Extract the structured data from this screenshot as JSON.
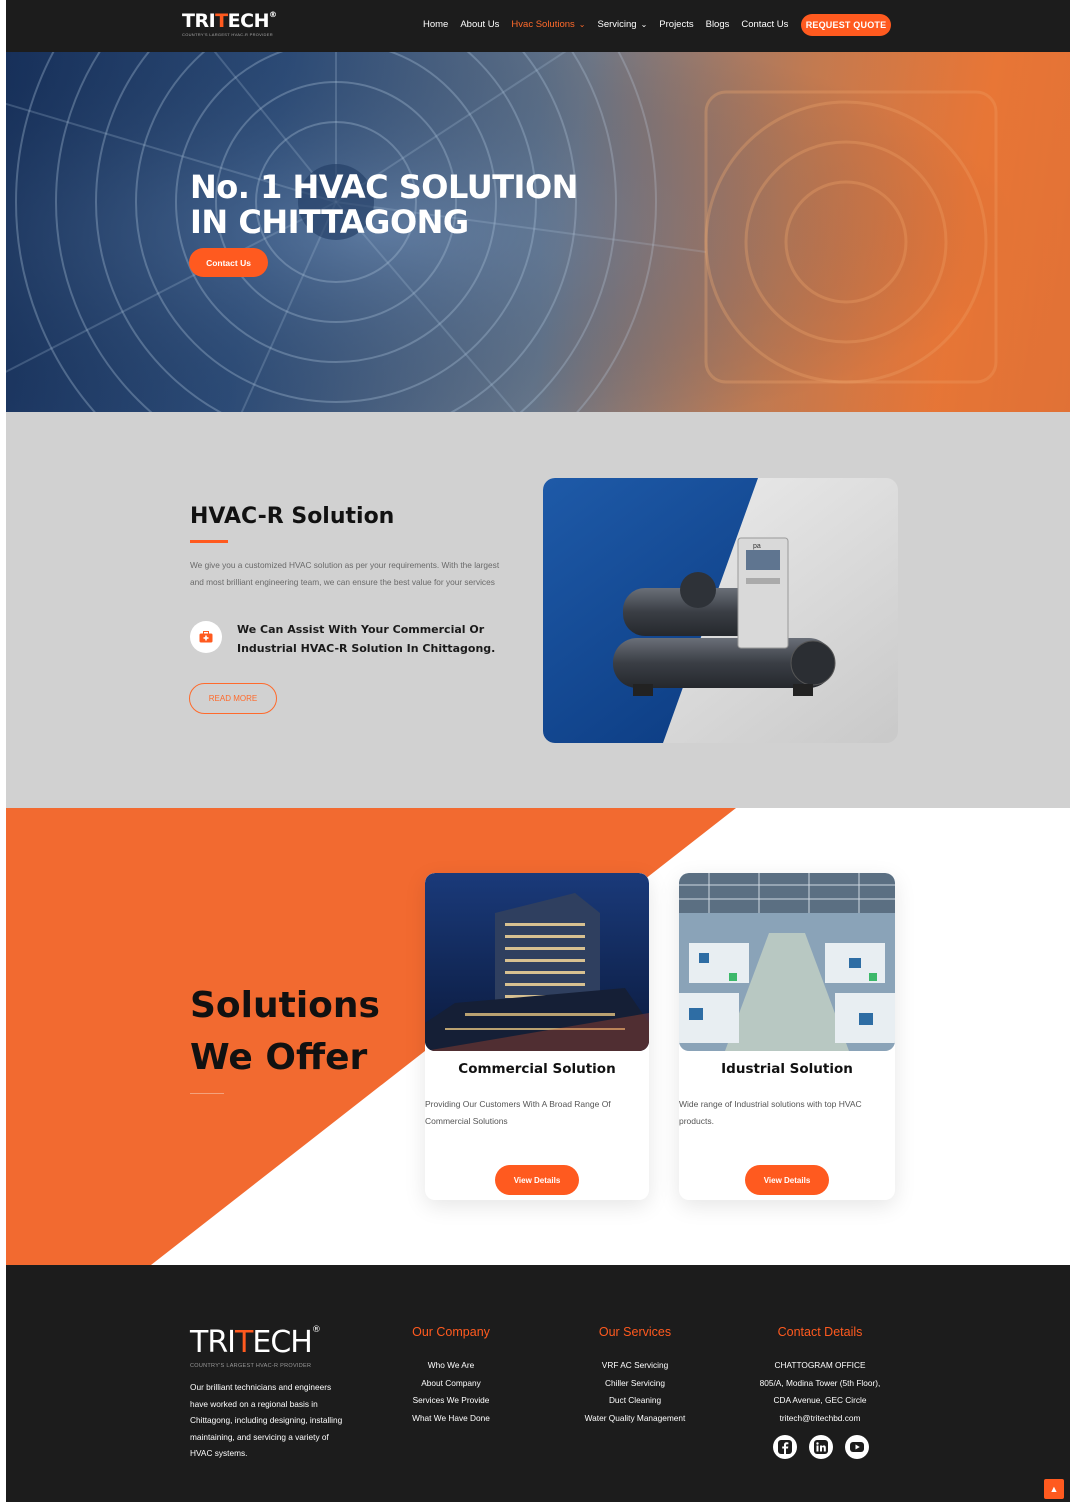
{
  "nav": {
    "logo": {
      "pre": "TRI",
      "mark": "T",
      "post": "ECH",
      "reg": "®"
    },
    "tagline": "COUNTRY'S LARGEST HVAC-R PROVIDER",
    "links": [
      {
        "label": "Home"
      },
      {
        "label": "About Us"
      },
      {
        "label": "Hvac Solutions",
        "dropdown": true,
        "active": true
      },
      {
        "label": "Servicing",
        "dropdown": true
      },
      {
        "label": "Projects"
      },
      {
        "label": "Blogs"
      },
      {
        "label": "Contact Us"
      }
    ],
    "quote_button": "REQUEST QUOTE"
  },
  "hero": {
    "title_line1": "No. 1 HVAC SOLUTION",
    "title_line2": "IN CHITTAGONG",
    "button": "Contact Us"
  },
  "hvac": {
    "title": "HVAC-R Solution",
    "description": "We give you a customized HVAC solution as per your requirements. With the largest and most brilliant engineering team, we can ensure the best value for your services",
    "assist_text": "We Can Assist With Your Commercial Or Industrial HVAC-R Solution In Chittagong.",
    "read_more": "READ MORE",
    "image_badge": "pa"
  },
  "solutions": {
    "title_line1": "Solutions",
    "title_line2": "We Offer",
    "cards": [
      {
        "title": "Commercial Solution",
        "description": "Providing Our Customers With A Broad Range Of Commercial Solutions",
        "button": "View Details"
      },
      {
        "title": "Idustrial Solution",
        "description": "Wide range of Industrial solutions with top HVAC products.",
        "button": "View Details"
      }
    ]
  },
  "footer": {
    "logo": {
      "pre": "TRI",
      "mark": "T",
      "post": "ECH",
      "reg": "®"
    },
    "tagline": "COUNTRY'S LARGEST HVAC-R PROVIDER",
    "about": "Our brilliant technicians and engineers have worked on a regional basis in Chittagong, including designing, installing maintaining, and servicing a variety of HVAC systems.",
    "company": {
      "title": "Our Company",
      "links": [
        "Who We Are",
        "About Company",
        "Services We Provide",
        "What We Have Done"
      ]
    },
    "services": {
      "title": "Our Services",
      "links": [
        "VRF AC Servicing",
        "Chiller Servicing",
        "Duct Cleaning",
        "Water Quality Management"
      ]
    },
    "contact": {
      "title": "Contact Details",
      "lines": [
        "CHATTOGRAM OFFICE",
        "805/A, Modina Tower (5th Floor),",
        "CDA Avenue, GEC Circle",
        "tritech@tritechbd.com"
      ]
    },
    "social_icons": [
      "facebook-icon",
      "linkedin-icon",
      "youtube-icon"
    ]
  },
  "colors": {
    "accent": "#ff5a1f",
    "nav_bg": "#1c1c1c",
    "section_gray": "#d1d1d1"
  }
}
